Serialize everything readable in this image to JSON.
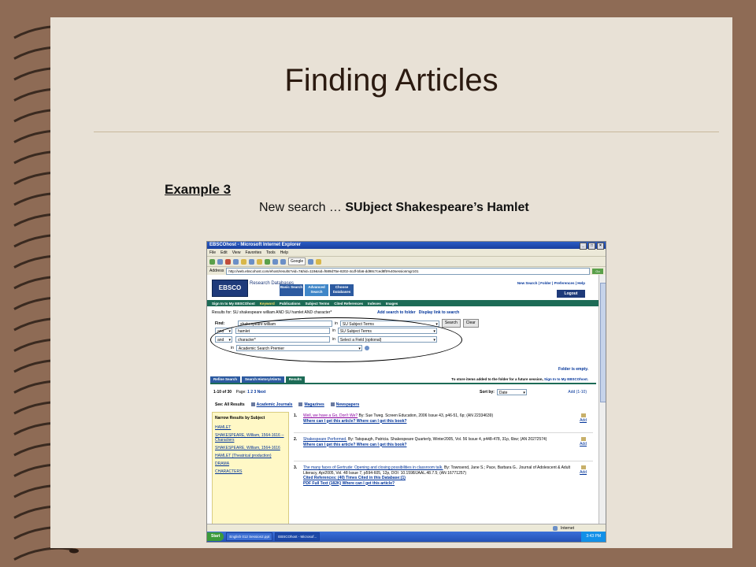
{
  "slide": {
    "title": "Finding Articles",
    "example": "Example 3",
    "subtitle_prefix": "New search … ",
    "subtitle_bold": "SUbject Shakespeare’s Hamlet"
  },
  "browser": {
    "window_title": "EBSCOhost - Microsoft Internet Explorer",
    "menu": [
      "File",
      "Edit",
      "View",
      "Favorites",
      "Tools",
      "Help"
    ],
    "google_label": "Google",
    "address_label": "Address",
    "address_value": "http://web.ebscohost.com/ehost/results?vid=7&hid=119&sid=f689d75e-8202-4cdf-bfa6-dd98c7ced8f5%40sessionmgr101",
    "go_label": "Go",
    "status_internet": "Internet"
  },
  "ebsco": {
    "logo": "EBSCO HOST",
    "research_databases": "Research Databases",
    "tabs": [
      "Basic Search",
      "Advanced Search",
      "Choose Databases"
    ],
    "top_links": [
      "New Search",
      "Folder",
      "Preferences",
      "Help"
    ],
    "logout": "Logout",
    "sign_in": "Sign In to My EBSCOhost",
    "nav": [
      "Keyword",
      "Publications",
      "Subject Terms",
      "Cited References",
      "Indexes",
      "Images"
    ],
    "results_for": "Results for: SU shakespeare william AND SU hamlet AND character*",
    "add_search": "Add search to folder",
    "display_link": "Display link to search",
    "find_label": "Find:",
    "rows": [
      {
        "bool": "",
        "term": "shakespeare william",
        "in": "in",
        "field": "SU Subject Terms"
      },
      {
        "bool": "and",
        "term": "hamlet",
        "in": "in",
        "field": "SU Subject Terms"
      },
      {
        "bool": "and",
        "term": "character*",
        "in": "in",
        "field": "Select a Field (optional)"
      }
    ],
    "search_btn": "Search",
    "clear_btn": "Clear",
    "db_in": "in",
    "db_value": "Academic Search Premier",
    "folder_empty": "Folder is empty.",
    "result_tabs": [
      "Refine Search",
      "Search History/Alerts",
      "Results"
    ],
    "store_text": "To store items added to the folder for a future session,",
    "store_link": "Sign In to My EBSCOhost.",
    "range": "1-10 of 30",
    "page_label": "Page:",
    "pages": [
      "1",
      "2",
      "3",
      "Next"
    ],
    "sort_label": "Sort by:",
    "sort_value": "Date",
    "add_range": "Add (1-10)",
    "see_all": "See: All Results",
    "see_links": [
      "Academic Journals",
      "Magazines",
      "Newspapers"
    ],
    "narrow_title": "Narrow Results by Subject",
    "narrow_items": [
      "HAMLET",
      "SHAKESPEARE, William, 1564-1616 -- Characters",
      "SHAKESPEARE, William, 1564-1616",
      "HAMLET (Theatrical production)",
      "DRAMA",
      "CHARACTERS"
    ],
    "results": [
      {
        "num": "1.",
        "title": "Well, we have a Go, Don't We?",
        "meta": " By: Sue Tweg. Screen Education, 2006 Issue 43, p46-51, 6p; (AN 22334639)",
        "links": "Where can I get this article?  Where can I get this book?"
      },
      {
        "num": "2.",
        "title": "Shakespeare Performed.",
        "meta": " By: Tatspaugh, Patricia. Shakespeare Quarterly, Winter2005, Vol. 56 Issue 4, p448-478, 31p, 6bw; (AN 20272574)",
        "links": "Where can I get this article?  Where can I get this book?"
      },
      {
        "num": "3.",
        "title": "The many faces of Gertrude: Opening and closing possibilities in classroom talk.",
        "meta": " By: Townsend, Jane S.; Pace, Barbara G.. Journal of Adolescent & Adult Literacy, Apr2005, Vol. 48 Issue 7, p594-605, 12p, DOI: 10.1598/JAAL.48.7.5; (AN 16771257)",
        "links": "Cited References: (40)  Times Cited in this Database:(1)",
        "links2": "PDF Full Text (182K)  Where can I get this article?"
      }
    ],
    "add_label": "Add"
  },
  "taskbar": {
    "start": "Start",
    "tasks": [
      "English 012 Session2.ppt",
      "EBSCOhost - Microsof..."
    ],
    "clock": "3:43 PM"
  }
}
